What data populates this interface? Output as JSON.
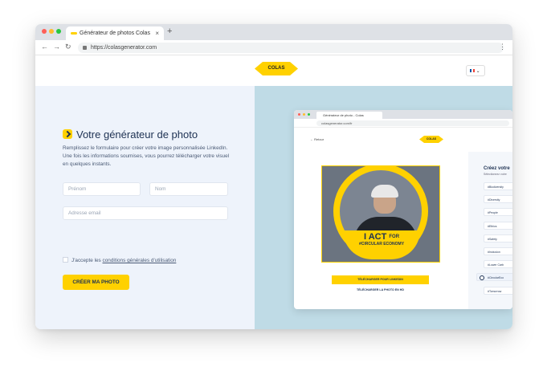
{
  "browser": {
    "tab_title": "Générateur de photos Colas",
    "tab_close": "×",
    "new_tab": "+",
    "back": "←",
    "forward": "→",
    "reload": "↻",
    "url": "https://colasgenerator.com",
    "menu": "⋮"
  },
  "site": {
    "logo_text": "COLAS",
    "lang_caret": "⌄"
  },
  "form": {
    "title": "Votre générateur de photo",
    "description": "Remplissez le formulaire pour créer votre image personnalisée LinkedIn. Une fois les informations soumises, vous pourrez télécharger votre visuel en quelques instants.",
    "firstname_placeholder": "Prénom",
    "lastname_placeholder": "Nom",
    "email_placeholder": "Adresse email",
    "terms_prefix": "J'accepte les ",
    "terms_link": "conditions générales d'utilisation",
    "submit": "CRÉER MA PHOTO"
  },
  "preview": {
    "tab_title": "Générateur de photo - Colas",
    "url": "colasgenerator.com/fr",
    "back": "← Retour",
    "logo_text": "COLAS",
    "banner_i": "I",
    "banner_act": "ACT",
    "banner_for": "FOR",
    "banner_sub": "#CIRCULAR ECONOMY",
    "download_linkedin": "TÉLÉCHARGER POUR LINKEDIN",
    "download_hd": "TÉLÉCHARGER LA PHOTO EN HD",
    "sidebar_title": "Créez votre",
    "sidebar_sub": "Sélectionnez votre",
    "hashtags": [
      "#Biodiversity",
      "#Diversity",
      "#People",
      "#Ethics",
      "#Safety",
      "#Inclusion",
      "#Lower Carb",
      "#CircularEco",
      "#Tomorrow"
    ],
    "selected_index": 7
  },
  "colors": {
    "accent": "#ffd100",
    "navy": "#1d3152",
    "left_bg": "#eef3fb",
    "right_bg": "#bfdbe6"
  }
}
